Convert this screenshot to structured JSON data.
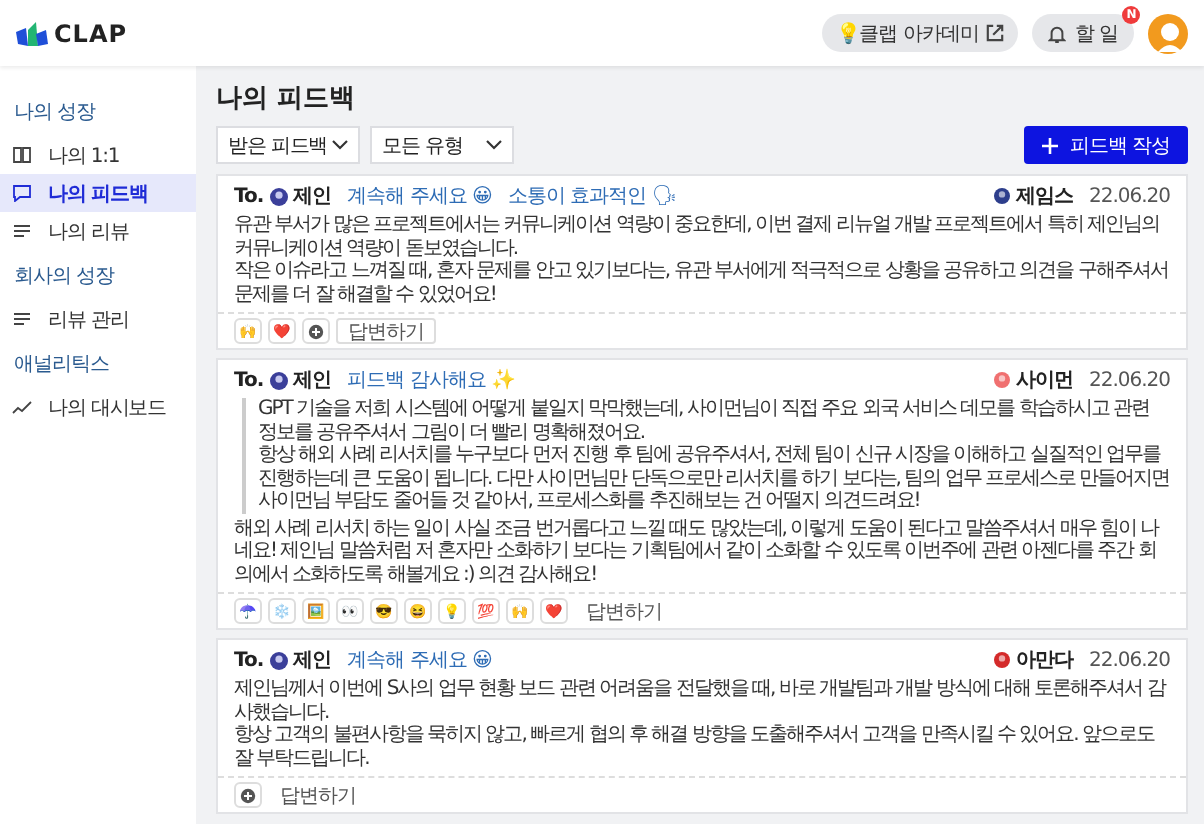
{
  "header": {
    "logo": "CLAP",
    "academy": "💡클랩 아카데미",
    "todo": "할 일",
    "todo_badge": "N"
  },
  "sidebar": {
    "sections": [
      {
        "title": "나의 성장",
        "items": [
          {
            "label": "나의 1:1",
            "selected": false
          },
          {
            "label": "나의 피드백",
            "selected": true
          },
          {
            "label": "나의 리뷰",
            "selected": false
          }
        ]
      },
      {
        "title": "회사의 성장",
        "items": [
          {
            "label": "리뷰 관리",
            "selected": false
          }
        ]
      },
      {
        "title": "애널리틱스",
        "items": [
          {
            "label": "나의 대시보드",
            "selected": false
          }
        ]
      }
    ]
  },
  "page": {
    "title": "나의 피드백",
    "filters": [
      "받은 피드백",
      "모든 유형"
    ],
    "create_button": "피드백 작성"
  },
  "feedbacks": [
    {
      "to_label": "To.",
      "to": "제인",
      "tags": [
        "계속해 주세요 😀",
        "소통이 효과적인 🗣"
      ],
      "author": "제임스",
      "date": "22.06.20",
      "body": [
        "유관 부서가 많은 프로젝트에서는 커뮤니케이션 역량이 중요한데, 이번 결제 리뉴얼 개발 프로젝트에서 특히 제인님의 커뮤니케이션 역량이 돋보였습니다.",
        "작은 이슈라고 느껴질 때, 혼자 문제를 안고 있기보다는, 유관 부서에게 적극적으로 상황을 공유하고 의견을 구해주셔서 문제를 더 잘 해결할 수 있었어요!"
      ],
      "reactions": [
        {
          "kind": "emoji",
          "text": "🙌"
        },
        {
          "kind": "emoji",
          "text": "❤️"
        },
        {
          "kind": "add"
        }
      ],
      "reply": "답변하기"
    },
    {
      "to_label": "To.",
      "to": "제인",
      "tags": [
        "피드백 감사해요 ✨"
      ],
      "author": "사이먼",
      "date": "22.06.20",
      "quote": [
        "GPT 기술을 저희 시스템에 어떻게 붙일지 막막했는데, 사이먼님이 직접 주요 외국 서비스 데모를 학습하시고 관련 정보를 공유주셔서 그림이 더 빨리 명확해졌어요.",
        "항상 해외 사례 리서치를 누구보다 먼저 진행 후 팀에 공유주셔서, 전체 팀이 신규 시장을 이해하고 실질적인 업무를 진행하는데 큰 도움이 됩니다. 다만 사이먼님만 단독으로만 리서치를 하기 보다는, 팀의 업무 프로세스로 만들어지면 사이먼님 부담도 줄어들 것 같아서, 프로세스화를 추진해보는 건 어떨지 의견드려요!"
      ],
      "body": [
        "해외 사례 리서치 하는 일이 사실 조금 번거롭다고 느낄 때도 많았는데, 이렇게 도움이 된다고 말씀주셔서 매우 힘이 나네요!  제인님 말씀처럼 저 혼자만 소화하기 보다는 기획팀에서 같이 소화할 수 있도록 이번주에 관련 아젠다를 주간 회의에서 소화하도록 해볼게요 :) 의견 감사해요!"
      ],
      "reactions": [
        {
          "kind": "emoji",
          "text": "☂️"
        },
        {
          "kind": "emoji",
          "text": "❄️"
        },
        {
          "kind": "emoji",
          "text": "🖼️"
        },
        {
          "kind": "emoji",
          "text": "👀"
        },
        {
          "kind": "emoji",
          "text": "😎"
        },
        {
          "kind": "emoji",
          "text": "😆"
        },
        {
          "kind": "emoji",
          "text": "💡"
        },
        {
          "kind": "emoji",
          "text": "💯"
        },
        {
          "kind": "emoji",
          "text": "🙌"
        },
        {
          "kind": "emoji",
          "text": "❤️"
        }
      ],
      "reply": "답변하기"
    },
    {
      "to_label": "To.",
      "to": "제인",
      "tags": [
        "계속해 주세요 😀"
      ],
      "author": "아만다",
      "date": "22.06.20",
      "body": [
        "제인님께서 이번에 S사의 업무 현황 보드 관련 어려움을 전달했을 때, 바로 개발팀과 개발 방식에 대해 토론해주셔서 감사했습니다.",
        "항상 고객의 불편사항을 묵히지 않고, 빠르게 협의 후 해결 방향을 도출해주셔서 고객을 만족시킬 수 있어요. 앞으로도 잘 부탁드립니다."
      ],
      "reactions": [
        {
          "kind": "add"
        }
      ],
      "reply": "답변하기"
    }
  ]
}
